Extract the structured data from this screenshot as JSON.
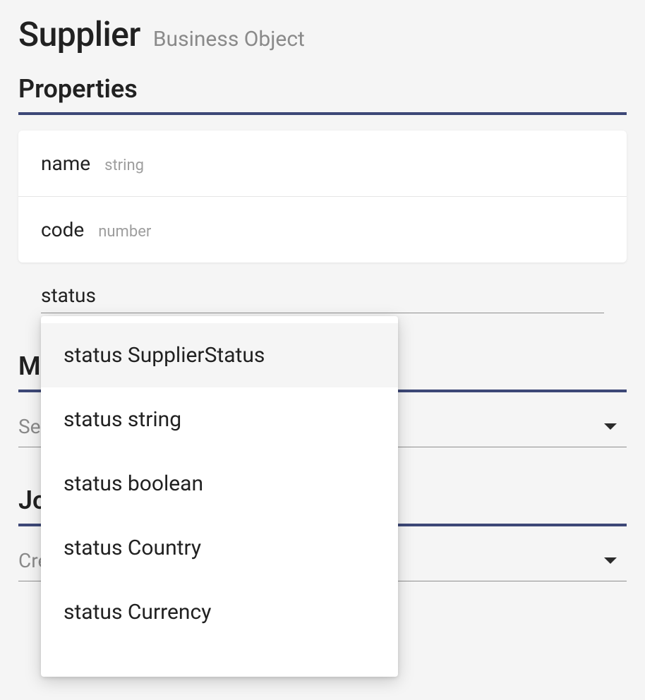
{
  "header": {
    "title": "Supplier",
    "subtitle": "Business Object"
  },
  "sections": {
    "properties_label": "Properties",
    "m_section_label": "M",
    "j_section_label": "Jo"
  },
  "properties": [
    {
      "name": "name",
      "type": "string"
    },
    {
      "name": "code",
      "type": "number"
    }
  ],
  "prop_input_value": "status",
  "autocomplete": {
    "items": [
      {
        "label": "status SupplierStatus",
        "highlight": true
      },
      {
        "label": "status string",
        "highlight": false
      },
      {
        "label": "status boolean",
        "highlight": false
      },
      {
        "label": "status Country",
        "highlight": false
      },
      {
        "label": "status Currency",
        "highlight": false
      }
    ]
  },
  "selects": {
    "first_placeholder": "Se",
    "second_placeholder": "Cre"
  }
}
